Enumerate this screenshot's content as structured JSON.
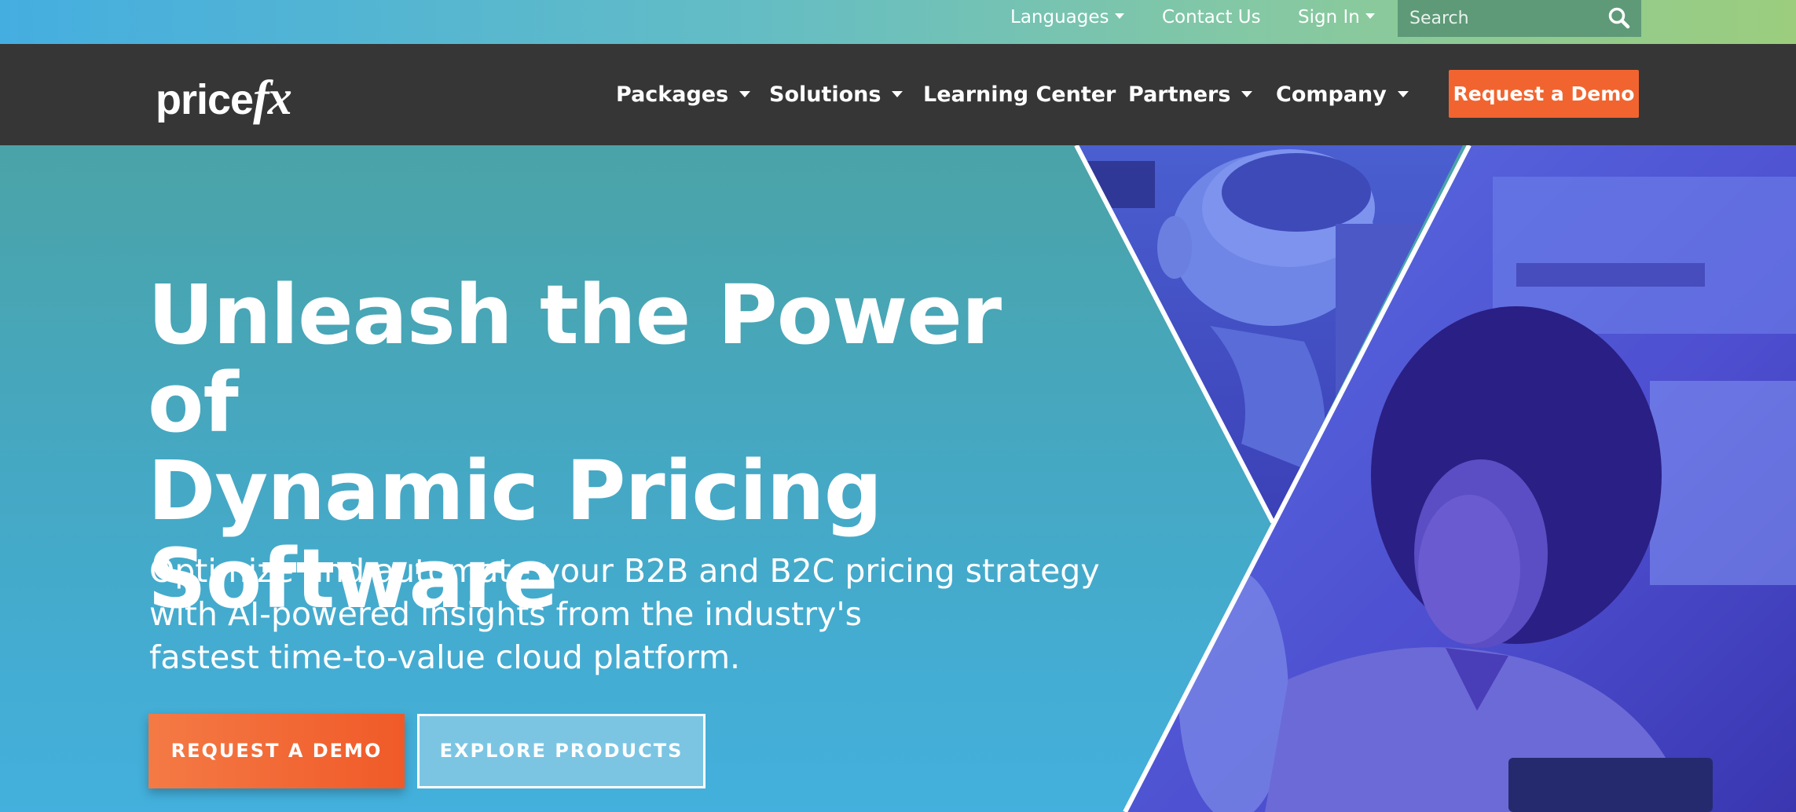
{
  "utility_bar": {
    "languages_label": "Languages",
    "contact_label": "Contact Us",
    "signin_label": "Sign In",
    "search_placeholder": "Search",
    "search_icon": "search-icon"
  },
  "nav": {
    "logo_text_a": "price",
    "logo_text_b": "fx",
    "items": [
      {
        "label": "Packages",
        "has_dropdown": true
      },
      {
        "label": "Solutions",
        "has_dropdown": true
      },
      {
        "label": "Learning Center",
        "has_dropdown": false
      },
      {
        "label": "Partners",
        "has_dropdown": true
      },
      {
        "label": "Company",
        "has_dropdown": true
      }
    ],
    "demo_label": "Request a Demo"
  },
  "hero": {
    "title_lines": [
      "Unleash the Power of",
      "Dynamic Pricing",
      "Software"
    ],
    "subtitle_lines": [
      "Optimize and automate your B2B and B2C pricing strategy",
      "with AI-powered insights from the industry's",
      "fastest time-to-value cloud platform."
    ],
    "primary_cta": "REQUEST A DEMO",
    "secondary_cta": "EXPLORE PRODUCTS"
  },
  "colors": {
    "accent_orange": "#f1642f",
    "nav_background": "#363636",
    "hero_teal": "#45a8c4",
    "photo_tint": "#5a5ae0"
  }
}
